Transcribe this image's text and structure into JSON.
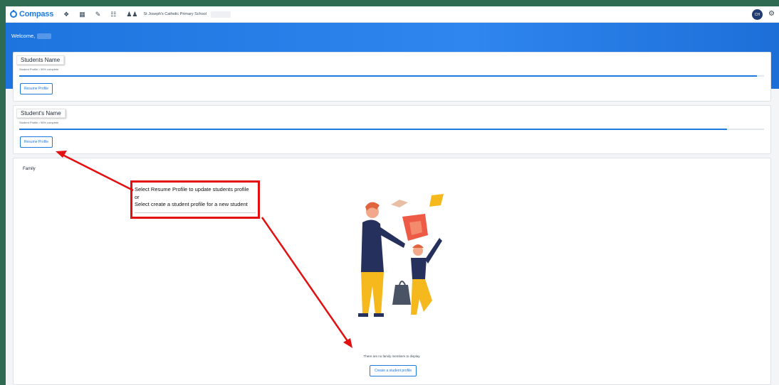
{
  "topbar": {
    "brand": "Compass",
    "school": "St Joseph's Catholic Primary School",
    "user_initials": "CH",
    "icons": [
      "home-icon",
      "calendar-icon",
      "pencil-icon",
      "grid-icon",
      "people-icon",
      "gear-icon"
    ]
  },
  "banner": {
    "welcome": "Welcome,"
  },
  "profiles": [
    {
      "name": "Students Name",
      "progress_label": "Student Profile • 99% complete",
      "progress": 0.99,
      "button": "Resume Profile"
    },
    {
      "name": "Student's Name",
      "progress_label": "Student Profile • 95% complete",
      "progress": 0.95,
      "button": "Resume Profile"
    }
  ],
  "family": {
    "title": "Family",
    "empty": "There are no family members to display.",
    "create_button": "Create a student profile"
  },
  "callout": {
    "line1": "Select Resume Profile to update students profile",
    "line2": "or",
    "line3": "Select create a student profile for a new student"
  },
  "colors": {
    "accent": "#1f7ae0",
    "banner": "#2f86ee",
    "annotation": "#e21010"
  }
}
